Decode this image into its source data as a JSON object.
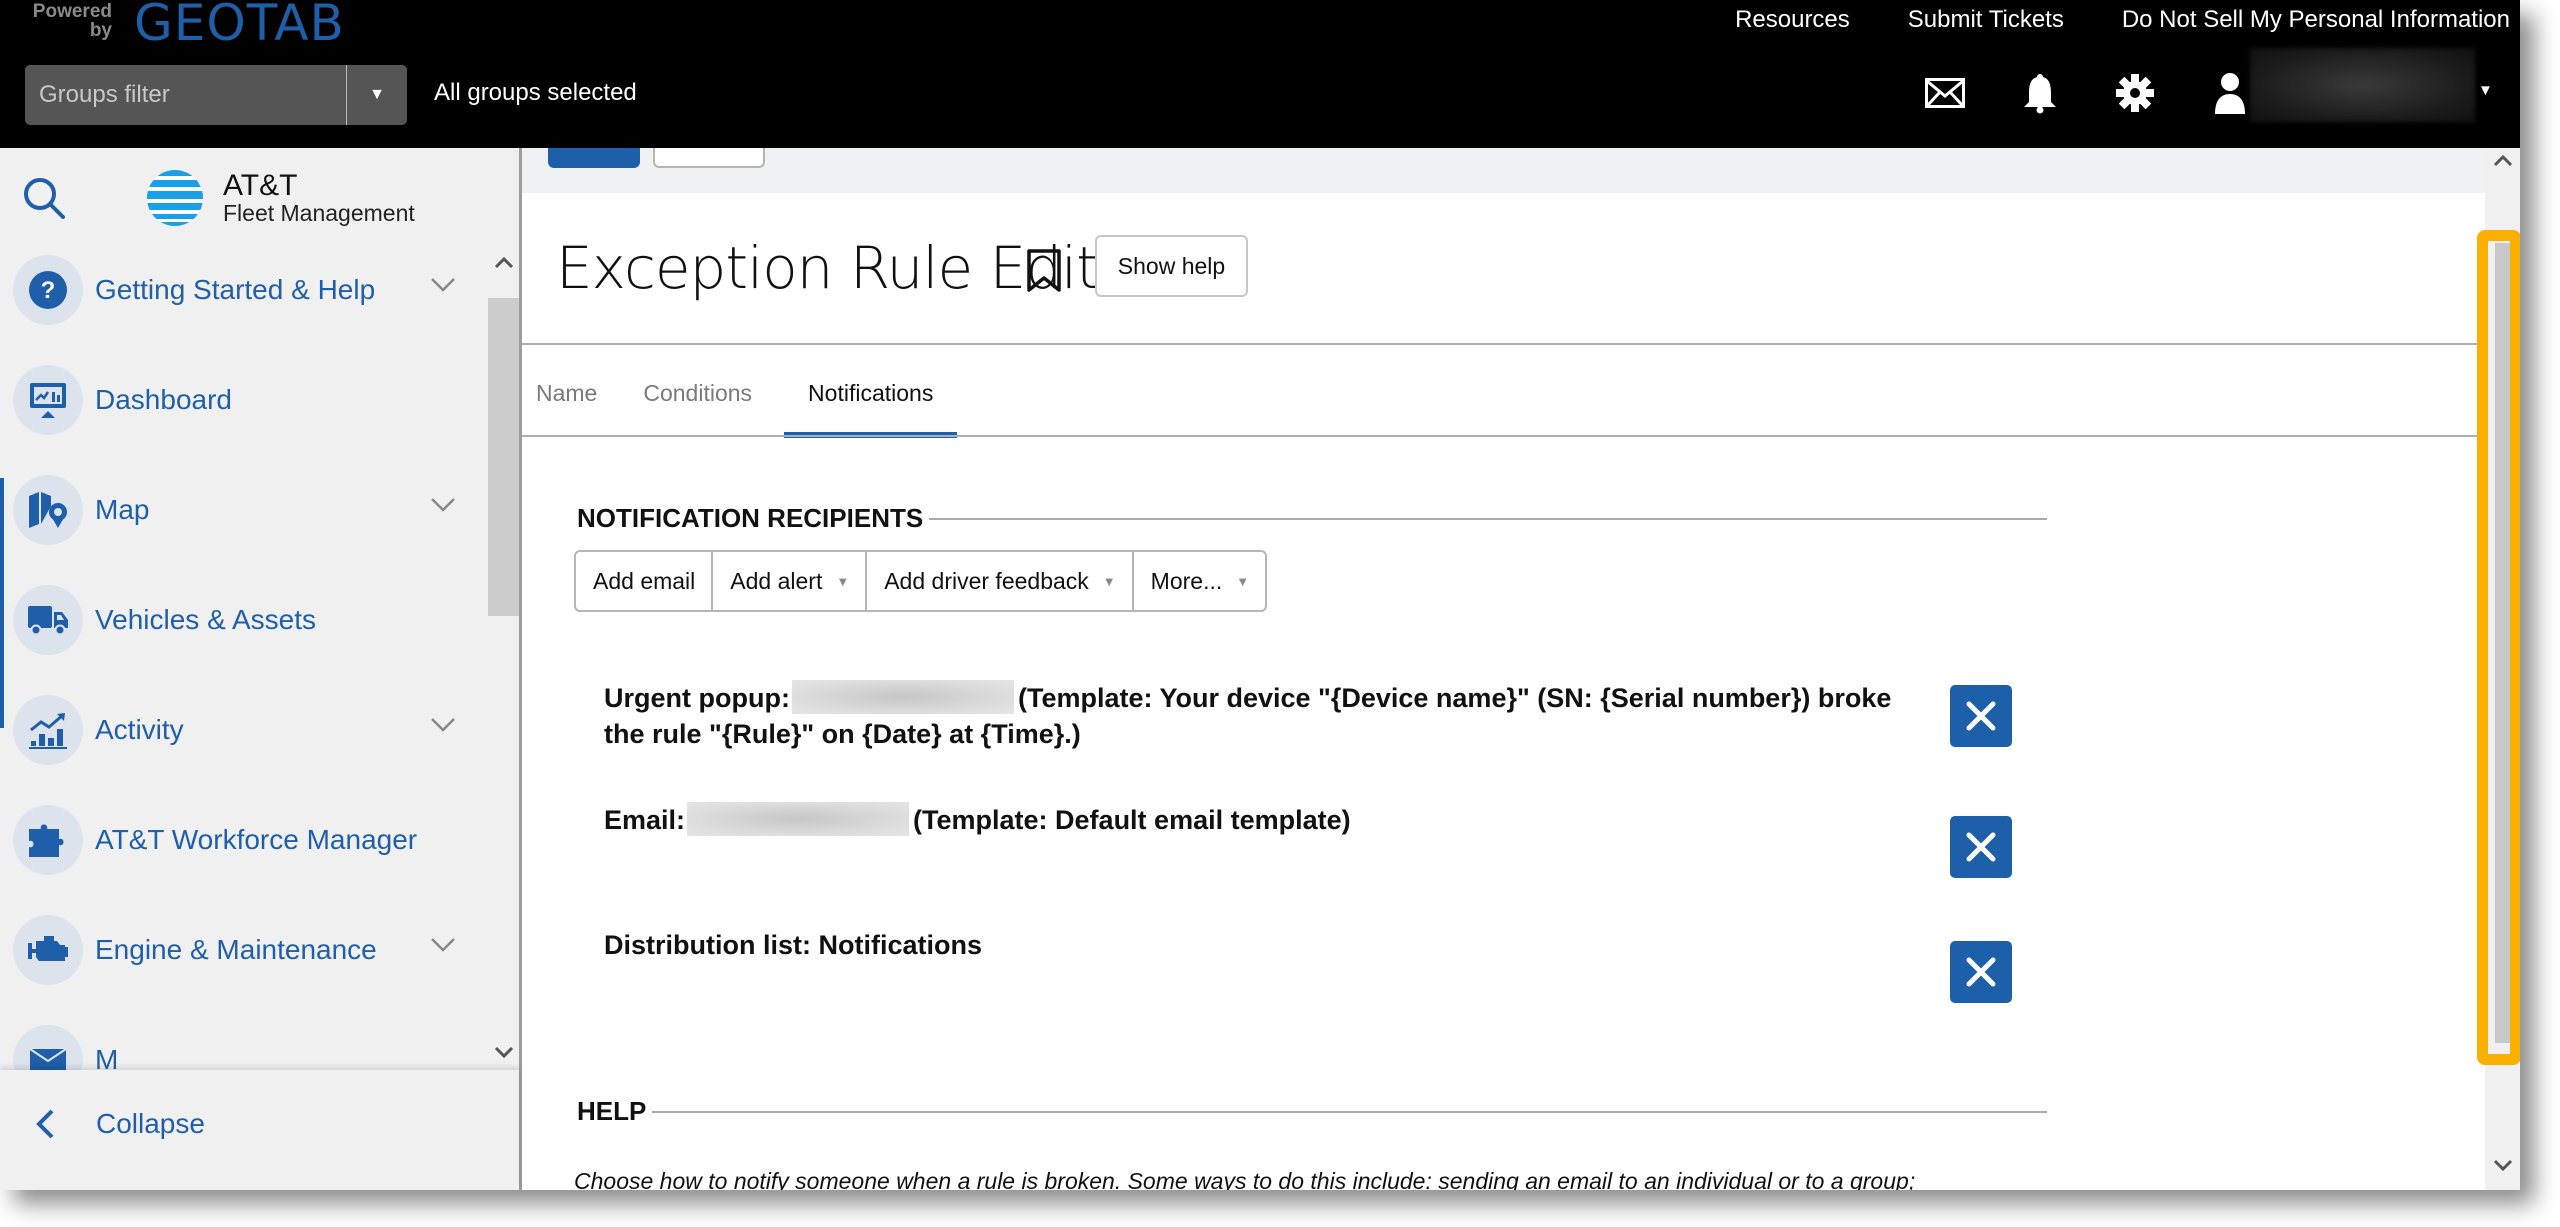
{
  "header": {
    "powered_by": "Powered by",
    "brand": "GEOTAB",
    "links": [
      "Resources",
      "Submit Tickets",
      "Do Not Sell My Personal Information"
    ],
    "groups_filter_placeholder": "Groups filter",
    "groups_status": "All groups selected",
    "icons": [
      "mail-icon",
      "bell-icon",
      "gear-icon",
      "user-icon"
    ]
  },
  "sidebar": {
    "logo_line1": "AT&T",
    "logo_line2": "Fleet Management",
    "items": [
      {
        "label": "Getting Started & Help",
        "icon": "help-icon",
        "expandable": true
      },
      {
        "label": "Dashboard",
        "icon": "dashboard-icon",
        "expandable": false
      },
      {
        "label": "Map",
        "icon": "map-icon",
        "expandable": true
      },
      {
        "label": "Vehicles & Assets",
        "icon": "truck-icon",
        "expandable": false
      },
      {
        "label": "Activity",
        "icon": "activity-icon",
        "expandable": true
      },
      {
        "label": "AT&T Workforce Manager",
        "icon": "puzzle-icon",
        "expandable": false
      },
      {
        "label": "Engine & Maintenance",
        "icon": "engine-icon",
        "expandable": true
      },
      {
        "label": "M",
        "icon": "message-icon",
        "expandable": false
      }
    ],
    "collapse_label": "Collapse"
  },
  "page": {
    "title": "Exception Rule Edit",
    "show_help_label": "Show help",
    "tabs": [
      {
        "label": "Name",
        "active": false
      },
      {
        "label": "Conditions",
        "active": false
      },
      {
        "label": "Notifications",
        "active": true
      }
    ],
    "recipients_heading": "NOTIFICATION RECIPIENTS",
    "buttons": [
      {
        "label": "Add email",
        "dropdown": false
      },
      {
        "label": "Add alert",
        "dropdown": true
      },
      {
        "label": "Add driver feedback",
        "dropdown": true
      },
      {
        "label": "More...",
        "dropdown": true
      }
    ],
    "recipients": [
      {
        "prefix": "Urgent popup:",
        "text": "(Template: Your device \"{Device name}\" (SN: {Serial number}) broke the rule \"{Rule}\" on {Date} at {Time}.)",
        "redacted": true
      },
      {
        "prefix": "Email:",
        "text": "(Template: Default email template)",
        "redacted": true
      },
      {
        "prefix": "Distribution list: Notifications",
        "text": "",
        "redacted": false
      }
    ],
    "help_heading": "HELP",
    "help_text": "Choose how to notify someone when a rule is broken. Some ways to do this include: sending an email to an individual or to a group;"
  },
  "colors": {
    "accent": "#1d5fa8",
    "highlight": "#fbb000",
    "sidebar_bg": "#f0f0f0",
    "header_bg": "#000000"
  }
}
